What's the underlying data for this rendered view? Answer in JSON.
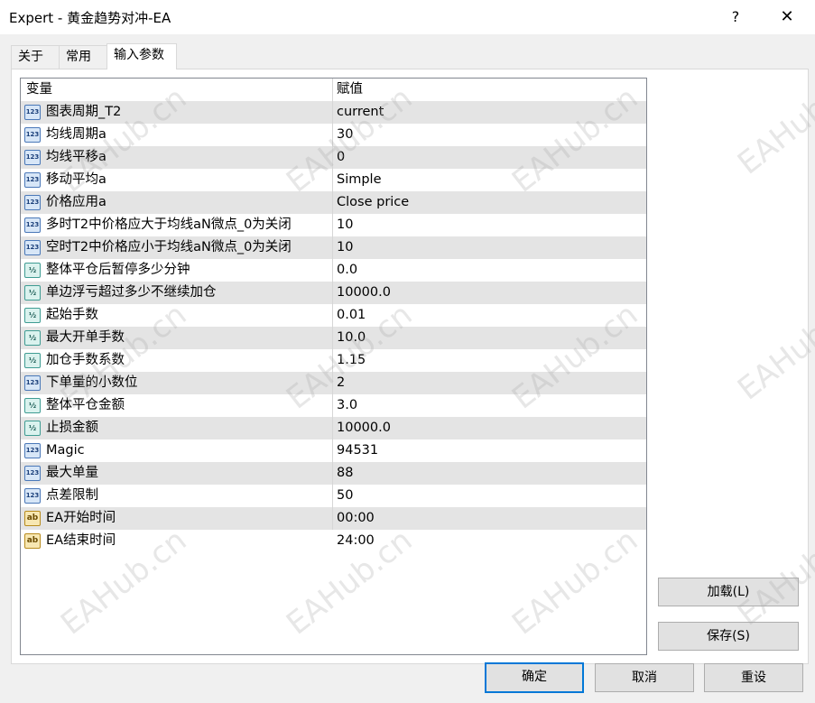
{
  "window": {
    "title": "Expert - 黄金趋势对冲-EA",
    "help": "?",
    "close": "✕"
  },
  "tabs": [
    {
      "label": "关于"
    },
    {
      "label": "常用"
    },
    {
      "label": "输入参数"
    }
  ],
  "grid": {
    "header": {
      "variable": "变量",
      "value": "赋值"
    },
    "rows": [
      {
        "type": "int",
        "icon": "123",
        "name": "图表周期_T2",
        "value": "current"
      },
      {
        "type": "int",
        "icon": "123",
        "name": "均线周期a",
        "value": "30"
      },
      {
        "type": "int",
        "icon": "123",
        "name": "均线平移a",
        "value": "0"
      },
      {
        "type": "int",
        "icon": "123",
        "name": "移动平均a",
        "value": "Simple"
      },
      {
        "type": "int",
        "icon": "123",
        "name": "价格应用a",
        "value": "Close price"
      },
      {
        "type": "int",
        "icon": "123",
        "name": "多时T2中价格应大于均线aN微点_0为关闭",
        "value": "10"
      },
      {
        "type": "int",
        "icon": "123",
        "name": "空时T2中价格应小于均线aN微点_0为关闭",
        "value": "10"
      },
      {
        "type": "dbl",
        "icon": "½",
        "name": "整体平仓后暂停多少分钟",
        "value": "0.0"
      },
      {
        "type": "dbl",
        "icon": "½",
        "name": "单边浮亏超过多少不继续加仓",
        "value": "10000.0"
      },
      {
        "type": "dbl",
        "icon": "½",
        "name": "起始手数",
        "value": "0.01"
      },
      {
        "type": "dbl",
        "icon": "½",
        "name": "最大开单手数",
        "value": "10.0"
      },
      {
        "type": "dbl",
        "icon": "½",
        "name": "加仓手数系数",
        "value": "1.15"
      },
      {
        "type": "int",
        "icon": "123",
        "name": "下单量的小数位",
        "value": "2"
      },
      {
        "type": "dbl",
        "icon": "½",
        "name": "整体平仓金额",
        "value": "3.0"
      },
      {
        "type": "dbl",
        "icon": "½",
        "name": "止损金额",
        "value": "10000.0"
      },
      {
        "type": "int",
        "icon": "123",
        "name": "Magic",
        "value": "94531"
      },
      {
        "type": "int",
        "icon": "123",
        "name": "最大单量",
        "value": "88"
      },
      {
        "type": "int",
        "icon": "123",
        "name": "点差限制",
        "value": "50"
      },
      {
        "type": "str",
        "icon": "ab",
        "name": "EA开始时间",
        "value": "00:00"
      },
      {
        "type": "str",
        "icon": "ab",
        "name": "EA结束时间",
        "value": "24:00"
      }
    ]
  },
  "side_buttons": {
    "load": "加载(L)",
    "save": "保存(S)"
  },
  "footer_buttons": {
    "ok": "确定",
    "cancel": "取消",
    "reset": "重设"
  },
  "watermark": "EAHub.cn"
}
